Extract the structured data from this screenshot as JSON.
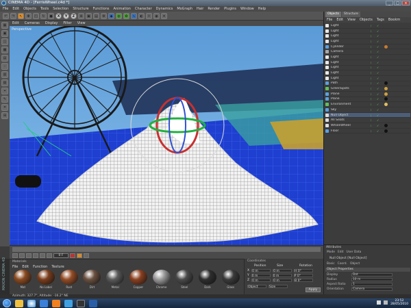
{
  "window": {
    "title": "CINEMA 4D - [FerrisWheel.c4d *]",
    "controls": [
      "_",
      "□",
      "×"
    ]
  },
  "menubar": [
    "File",
    "Edit",
    "Objects",
    "Tools",
    "Selection",
    "Structure",
    "Functions",
    "Animation",
    "Character",
    "Dynamics",
    "MoGraph",
    "Hair",
    "Render",
    "Plugins",
    "Window",
    "Help"
  ],
  "toolbar": {
    "axis_labels": [
      "X",
      "Y",
      "Z"
    ]
  },
  "viewport": {
    "menu": [
      "Edit",
      "Cameras",
      "Display",
      "Filter",
      "View"
    ],
    "label": "Perspective"
  },
  "timeline": {
    "frame": "0 F"
  },
  "materials": {
    "header": "Materials",
    "menu": [
      "File",
      "Edit",
      "Function",
      "Texture"
    ],
    "items": [
      {
        "label": "Mat",
        "color": "#8a4a20"
      },
      {
        "label": "No Label",
        "color": "#7a3d1c"
      },
      {
        "label": "Rust",
        "color": "#944c26"
      },
      {
        "label": "Dirt",
        "color": "#6a5040"
      },
      {
        "label": "Metal",
        "color": "#5a5a5a"
      },
      {
        "label": "Copper",
        "color": "#8a4020"
      },
      {
        "label": "Chrome",
        "color": "#9a9a9a"
      },
      {
        "label": "Steel",
        "color": "#4a4a4a"
      },
      {
        "label": "Dark",
        "color": "#2e2e2e"
      },
      {
        "label": "Glass",
        "color": "#3a3a3a"
      }
    ]
  },
  "coordinates": {
    "header": "Coordinates",
    "columns": [
      "Position",
      "Size",
      "Rotation"
    ],
    "rows": [
      {
        "axis": "X",
        "p": "0 m",
        "s": "0 m",
        "r": "H 0°"
      },
      {
        "axis": "Y",
        "p": "0 m",
        "s": "0 m",
        "r": "P 0°"
      },
      {
        "axis": "Z",
        "p": "0 m",
        "s": "0 m",
        "r": "B 0°"
      }
    ],
    "mode_a": "Object",
    "mode_b": "Size",
    "apply": "Apply"
  },
  "objects": {
    "tabs": [
      "Objects",
      "Structure"
    ],
    "menu": [
      "File",
      "Edit",
      "View",
      "Objects",
      "Tags",
      "Bookm"
    ],
    "items": [
      {
        "name": "Light",
        "color": "#e8e8e8",
        "tag": ""
      },
      {
        "name": "Light",
        "color": "#e8e8e8",
        "tag": ""
      },
      {
        "name": "Light",
        "color": "#e8e8e8",
        "tag": ""
      },
      {
        "name": "Light",
        "color": "#e8e8e8",
        "tag": ""
      },
      {
        "name": "Cylinder",
        "color": "#5aa0e0",
        "tag": "#c87a30"
      },
      {
        "name": "Camera",
        "color": "#aaaaaa",
        "tag": ""
      },
      {
        "name": "Light",
        "color": "#e8e8e8",
        "tag": ""
      },
      {
        "name": "Light",
        "color": "#e8e8e8",
        "tag": ""
      },
      {
        "name": "Light",
        "color": "#e8e8e8",
        "tag": ""
      },
      {
        "name": "Light",
        "color": "#e8e8e8",
        "tag": ""
      },
      {
        "name": "Light",
        "color": "#e8e8e8",
        "tag": ""
      },
      {
        "name": "Path",
        "color": "#5aa0e0",
        "tag": "#111111"
      },
      {
        "name": "GreenSpots",
        "color": "#60c060",
        "tag": "#d0a040"
      },
      {
        "name": "Plane",
        "color": "#5aa0e0",
        "tag": "#d0a040"
      },
      {
        "name": "Plane",
        "color": "#5aa0e0",
        "tag": "#111111"
      },
      {
        "name": "Environment",
        "color": "#60c060",
        "tag": "#e0c060"
      },
      {
        "name": "Sky",
        "color": "#5aa0e0",
        "tag": ""
      },
      {
        "name": "Null Object",
        "color": "#dddddd",
        "tag": ""
      },
      {
        "name": "All Seats",
        "color": "#dddddd",
        "tag": ""
      },
      {
        "name": "WholeWheel",
        "color": "#dddddd",
        "tag": "#111111"
      },
      {
        "name": "Floor",
        "color": "#5aa0e0",
        "tag": "#111111"
      }
    ]
  },
  "attributes": {
    "header": "Attributes",
    "menu": [
      "Mode",
      "Edit",
      "User Data"
    ],
    "title": "Null Object [Null Object]",
    "tabs": [
      "Basic",
      "Coord.",
      "Object"
    ],
    "section": "Object Properties",
    "props": [
      {
        "label": "Display",
        "value": "Dot"
      },
      {
        "label": "Radius",
        "value": "10 m"
      },
      {
        "label": "Aspect Ratio",
        "value": "1"
      },
      {
        "label": "Orientation",
        "value": "Camera"
      }
    ]
  },
  "status": {
    "text": "Azimuth: 327.7°, Altitude: -16.2°  NE"
  },
  "brand": "MAXON CINEMA 4D",
  "clock": {
    "time": "23:52",
    "date": "28/05/2010"
  }
}
